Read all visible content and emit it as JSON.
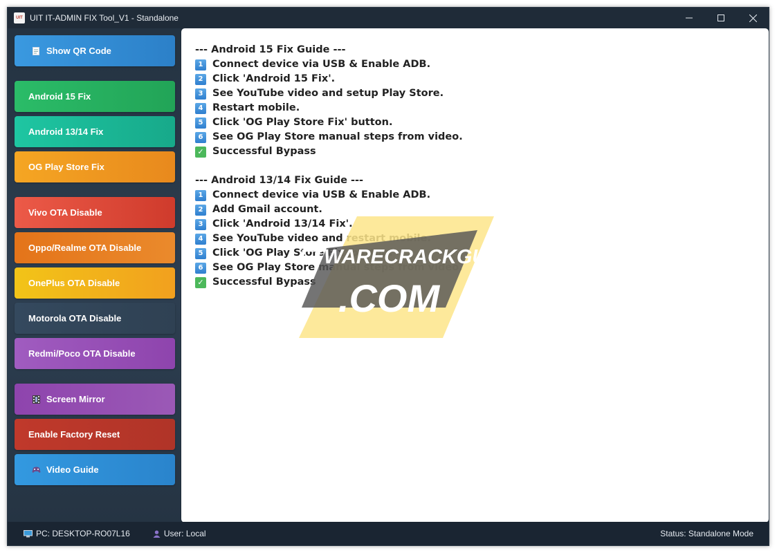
{
  "window": {
    "title": "UIT IT-ADMIN FIX Tool_V1 - Standalone",
    "app_icon_text": "UIT"
  },
  "sidebar": {
    "buttons": [
      {
        "label": "Show QR Code",
        "icon": "document-icon",
        "color": "#3a8ed8"
      },
      {
        "label": "Android 15 Fix",
        "color": "#27ae60"
      },
      {
        "label": "Android 13/14 Fix",
        "color": "#1abc9c"
      },
      {
        "label": "OG Play Store Fix",
        "color": "#f39c12"
      },
      {
        "label": "Vivo OTA Disable",
        "color": "#e74c3c"
      },
      {
        "label": "Oppo/Realme OTA Disable",
        "color": "#e67e22"
      },
      {
        "label": "OnePlus OTA Disable",
        "color": "#f1c40f"
      },
      {
        "label": "Motorola OTA Disable",
        "color": "#34495e"
      },
      {
        "label": "Redmi/Poco OTA Disable",
        "color": "#9b59b6"
      },
      {
        "label": "Screen Mirror",
        "icon": "film-icon",
        "color": "#8e44ad"
      },
      {
        "label": "Enable Factory Reset",
        "color": "#c0392b"
      },
      {
        "label": "Video Guide",
        "icon": "gamepad-icon",
        "color": "#2d8ad6"
      }
    ]
  },
  "guide": {
    "a15": {
      "heading": "--- Android 15 Fix Guide ---",
      "steps": [
        "Connect device via USB & Enable ADB.",
        "Click 'Android 15 Fix'.",
        "See YouTube video and setup Play Store.",
        "Restart mobile.",
        "Click 'OG Play Store Fix' button.",
        "See OG Play Store manual steps from video."
      ],
      "success": "Successful Bypass"
    },
    "a1314": {
      "heading": "--- Android 13/14 Fix Guide ---",
      "steps": [
        "Connect device via USB & Enable ADB.",
        "Add Gmail account.",
        "Click 'Android 13/14 Fix'.",
        "See YouTube video and restart mobile.",
        "Click 'OG Play Store Fix' button.",
        "See OG Play Store manual steps from video."
      ],
      "success": "Successful Bypass"
    },
    "step_numbers": [
      "1",
      "2",
      "3",
      "4",
      "5",
      "6"
    ]
  },
  "watermark": {
    "line1": "SOFTWARECRACKGURU",
    "line2": ".COM"
  },
  "statusbar": {
    "pc": "PC: DESKTOP-RO07L16",
    "user": "User: Local",
    "mode": "Status: Standalone Mode"
  }
}
